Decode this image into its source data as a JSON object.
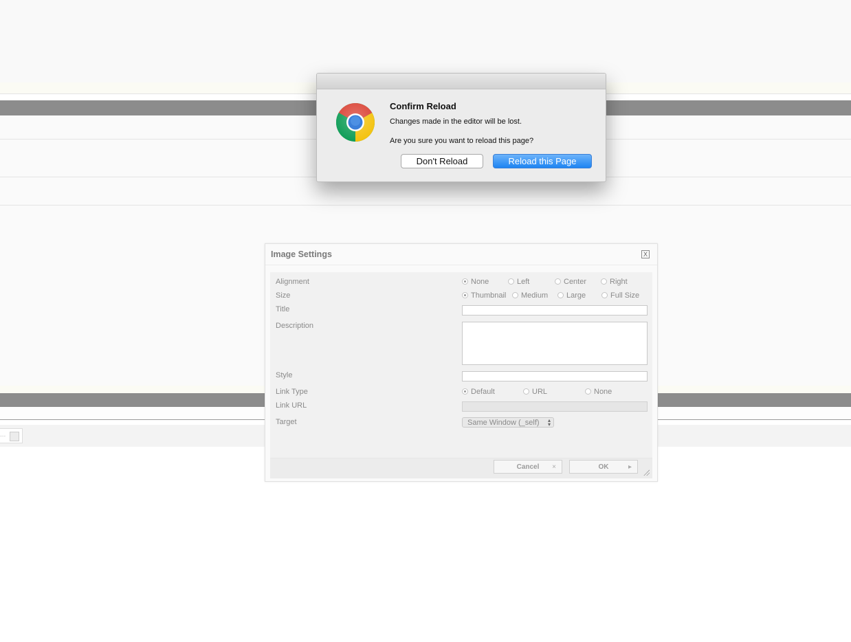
{
  "confirm_dialog": {
    "title": "Confirm Reload",
    "message_line1": "Changes made in the editor will be lost.",
    "message_line2": "Are you sure you want to reload this page?",
    "dont_reload_label": "Don't Reload",
    "reload_label": "Reload this Page",
    "logo_icon": "chrome-logo-icon"
  },
  "image_settings": {
    "title": "Image Settings",
    "close_label": "X",
    "labels": {
      "alignment": "Alignment",
      "size": "Size",
      "title": "Title",
      "description": "Description",
      "style": "Style",
      "link_type": "Link Type",
      "link_url": "Link URL",
      "target": "Target"
    },
    "alignment_options": [
      "None",
      "Left",
      "Center",
      "Right"
    ],
    "alignment_selected": "None",
    "size_options": [
      "Thumbnail",
      "Medium",
      "Large",
      "Full Size"
    ],
    "size_selected": "Thumbnail",
    "link_type_options": [
      "Default",
      "URL",
      "None"
    ],
    "link_type_selected": "Default",
    "title_value": "",
    "description_value": "",
    "style_value": "",
    "link_url_value": "",
    "target_selected": "Same Window (_self)",
    "cancel_label": "Cancel",
    "ok_label": "OK"
  },
  "background": {
    "toolbar_mini_text": "..."
  }
}
